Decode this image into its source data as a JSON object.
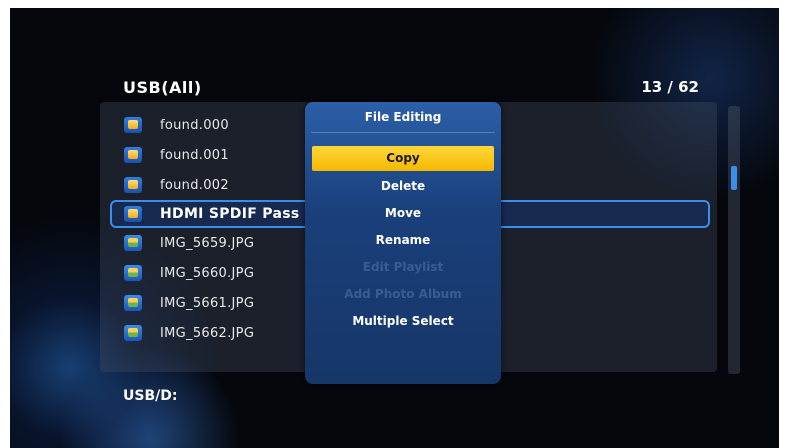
{
  "header": {
    "title": "USB(All)",
    "page_counter": "13 / 62"
  },
  "files": [
    {
      "name": "found.000",
      "type": "folder"
    },
    {
      "name": "found.001",
      "type": "folder"
    },
    {
      "name": "found.002",
      "type": "folder"
    },
    {
      "name": "HDMI SPDIF Pass",
      "type": "folder",
      "selected": true
    },
    {
      "name": "IMG_5659.JPG",
      "type": "image"
    },
    {
      "name": "IMG_5660.JPG",
      "type": "image"
    },
    {
      "name": "IMG_5661.JPG",
      "type": "image"
    },
    {
      "name": "IMG_5662.JPG",
      "type": "image"
    }
  ],
  "footer": {
    "path": "USB/D:"
  },
  "dialog": {
    "title": "File Editing",
    "items": [
      {
        "label": "Copy",
        "state": "active"
      },
      {
        "label": "Delete",
        "state": "enabled"
      },
      {
        "label": "Move",
        "state": "enabled"
      },
      {
        "label": "Rename",
        "state": "enabled"
      },
      {
        "label": "Edit Playlist",
        "state": "disabled"
      },
      {
        "label": "Add Photo Album",
        "state": "disabled"
      },
      {
        "label": "Multiple Select",
        "state": "enabled"
      }
    ]
  },
  "colors": {
    "accent_blue": "#3d8ee8",
    "highlight_yellow": "#ffd73a",
    "dialog_blue": "#1a3f7a",
    "background": "#05070d"
  }
}
